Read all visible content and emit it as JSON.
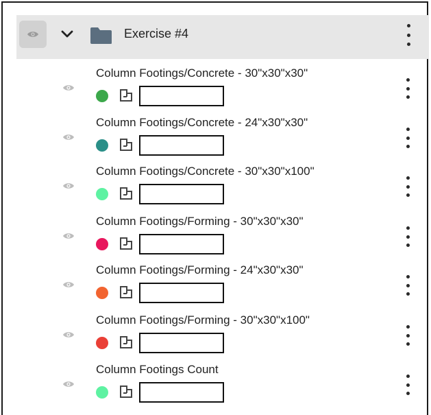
{
  "group": {
    "title": "Exercise #4",
    "expanded": true,
    "visible_toggle_icon": "eye-icon",
    "expand_icon": "chevron-down-icon",
    "folder_icon": "folder-icon",
    "menu_icon": "kebab-menu-icon",
    "folder_color": "#5b6e7f"
  },
  "layers": [
    {
      "name": "Column Footings/Concrete - 30\"x30\"x30\"",
      "color": "#3ca84b",
      "value": ""
    },
    {
      "name": "Column Footings/Concrete - 24\"x30\"x30\"",
      "color": "#2a8f88",
      "value": ""
    },
    {
      "name": "Column Footings/Concrete - 30\"x30\"x100\"",
      "color": "#5ef2a2",
      "value": ""
    },
    {
      "name": "Column Footings/Forming - 30\"x30\"x30\"",
      "color": "#e8175d",
      "value": ""
    },
    {
      "name": "Column Footings/Forming - 24\"x30\"x30\"",
      "color": "#f26430",
      "value": ""
    },
    {
      "name": "Column Footings/Forming - 30\"x30\"x100\"",
      "color": "#ea3f36",
      "value": ""
    },
    {
      "name": "Column Footings Count",
      "color": "#5ef2a2",
      "value": ""
    }
  ]
}
